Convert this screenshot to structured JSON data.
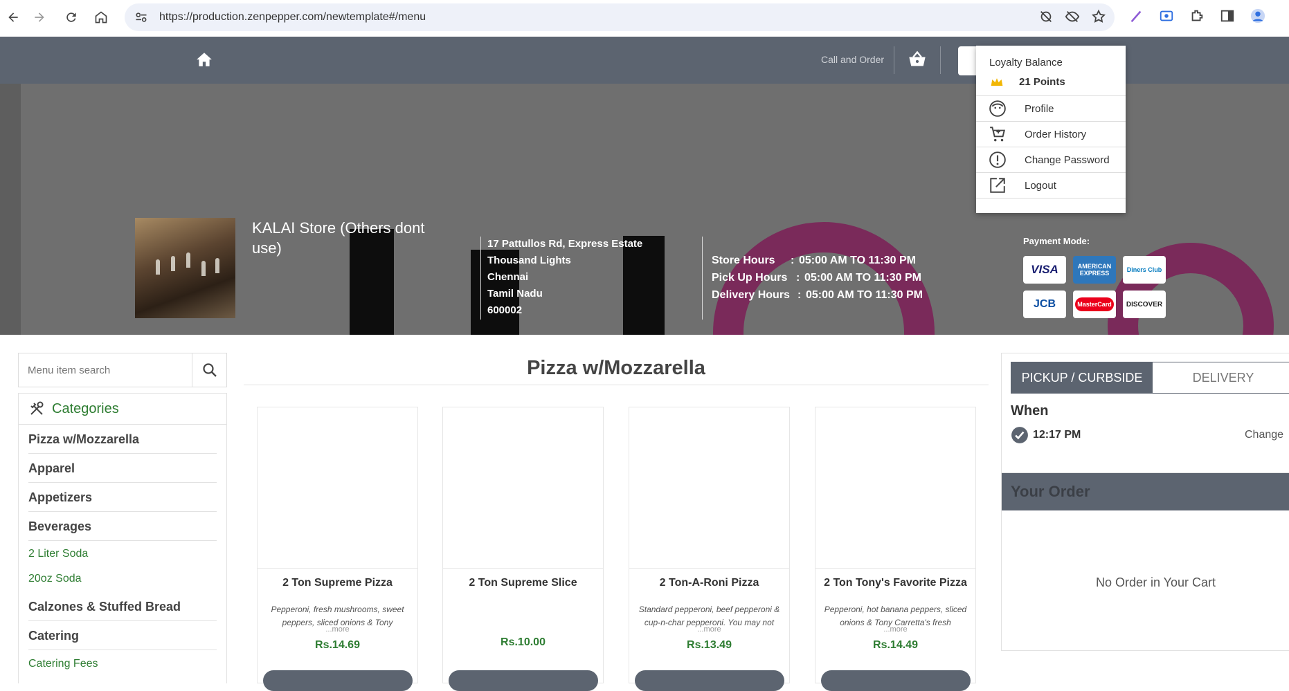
{
  "browser": {
    "url": "https://production.zenpepper.com/newtemplate#/menu"
  },
  "header": {
    "call_and_order": "Call and Order"
  },
  "account_menu": {
    "loyalty_label": "Loyalty Balance",
    "points": "21 Points",
    "items": [
      {
        "label": "Profile",
        "icon": "smiley-icon"
      },
      {
        "label": "Order History",
        "icon": "cart-icon"
      },
      {
        "label": "Change Password",
        "icon": "exclamation-icon"
      },
      {
        "label": "Logout",
        "icon": "external-link-icon"
      }
    ]
  },
  "store": {
    "name": "KALAI Store (Others dont use)",
    "address_lines": [
      "17 Pattullos Rd, Express Estate",
      "Thousand Lights",
      "Chennai",
      "Tamil Nadu",
      "600002"
    ],
    "hours": [
      {
        "label": "Store Hours",
        "sep": ":",
        "value": "05:00 AM TO 11:30 PM"
      },
      {
        "label": "Pick Up Hours",
        "sep": ":",
        "value": "05:00 AM TO 11:30 PM"
      },
      {
        "label": "Delivery Hours",
        "sep": ":",
        "value": "05:00 AM TO 11:30 PM"
      }
    ],
    "payment_title": "Payment Mode:",
    "cards": [
      {
        "label": "VISA",
        "color": "#1a1f71"
      },
      {
        "label": "AMERICAN EXPRESS",
        "color": "#2e77bb"
      },
      {
        "label": "Diners Club",
        "color": "#0079be"
      },
      {
        "label": "JCB",
        "color": "#0b4ea2"
      },
      {
        "label": "MasterCard",
        "color": "#eb001b"
      },
      {
        "label": "DISCOVER",
        "color": "#222222"
      }
    ]
  },
  "sidebar": {
    "search_placeholder": "Menu item search",
    "categories_title": "Categories",
    "categories": [
      {
        "label": "Pizza w/Mozzarella",
        "sub": false
      },
      {
        "label": "Apparel",
        "sub": false
      },
      {
        "label": "Appetizers",
        "sub": false
      },
      {
        "label": "Beverages",
        "sub": false
      },
      {
        "label": "2 Liter Soda",
        "sub": true
      },
      {
        "label": "20oz Soda",
        "sub": true
      },
      {
        "label": "Calzones & Stuffed Bread",
        "sub": false
      },
      {
        "label": "Catering",
        "sub": false
      },
      {
        "label": "Catering Fees",
        "sub": true
      }
    ]
  },
  "main": {
    "title": "Pizza w/Mozzarella",
    "products": [
      {
        "name": "2 Ton Supreme Pizza",
        "desc": "Pepperoni, fresh mushrooms, sweet peppers, sliced onions & Tony",
        "more": "...more",
        "price": "Rs.14.69"
      },
      {
        "name": "2 Ton Supreme Slice",
        "desc": "",
        "more": "",
        "price": "Rs.10.00"
      },
      {
        "name": "2 Ton-A-Roni Pizza",
        "desc": "Standard pepperoni, beef pepperoni & cup-n-char pepperoni. You may not",
        "more": "...more",
        "price": "Rs.13.49"
      },
      {
        "name": "2 Ton Tony's Favorite Pizza",
        "desc": "Pepperoni, hot banana peppers, sliced onions & Tony Carretta's fresh",
        "more": "...more",
        "price": "Rs.14.49"
      }
    ]
  },
  "order_panel": {
    "tab_pickup": "PICKUP / CURBSIDE",
    "tab_delivery": "DELIVERY",
    "when_label": "When",
    "time": "12:17 PM",
    "change": "Change",
    "your_order": "Your Order",
    "empty": "No Order in Your Cart"
  }
}
